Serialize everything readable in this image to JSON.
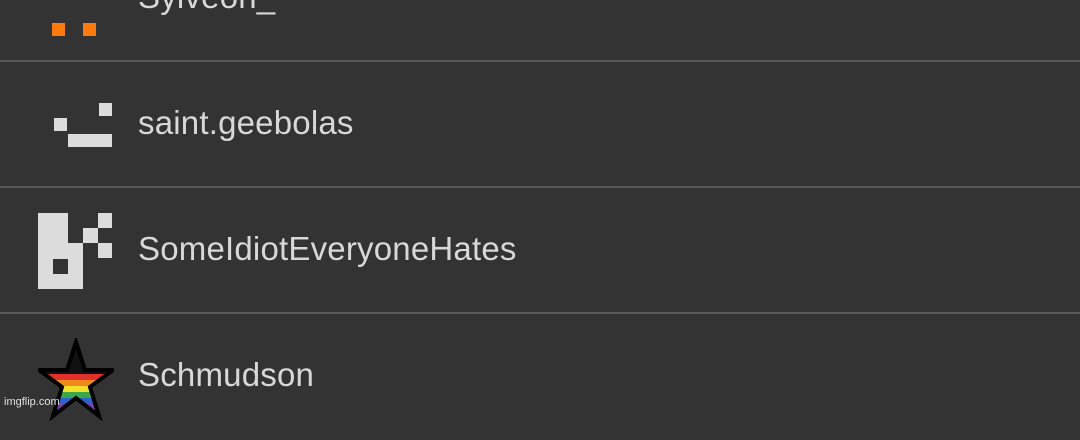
{
  "users": [
    {
      "name": "Sylveon_",
      "avatar_icon": "orange-pixel-identicon-icon",
      "avatar_color": "#ff7a0d"
    },
    {
      "name": "saint.geebolas",
      "avatar_icon": "gray-pixel-identicon-icon",
      "avatar_color": "#dcdcdc"
    },
    {
      "name": "SomeIdiotEveryoneHates",
      "avatar_icon": "gray-pixel-identicon-icon",
      "avatar_color": "#dcdcdc"
    },
    {
      "name": "Schmudson",
      "avatar_icon": "rainbow-star-icon",
      "avatar_color": "#000000"
    }
  ],
  "watermark": "imgflip.com",
  "colors": {
    "background": "#333333",
    "divider": "#5a5a5a",
    "text": "#d8d8d8"
  }
}
